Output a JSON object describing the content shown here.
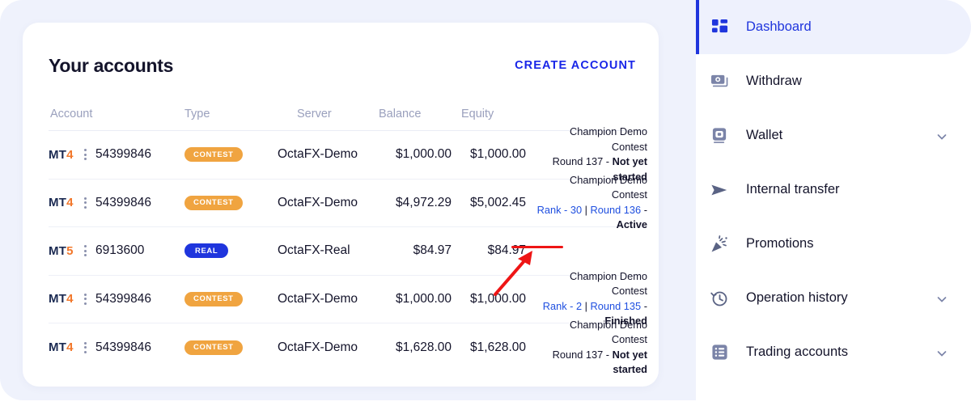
{
  "card": {
    "title": "Your accounts",
    "create_button": "CREATE ACCOUNT"
  },
  "table": {
    "headers": {
      "account": "Account",
      "type": "Type",
      "server": "Server",
      "balance": "Balance",
      "equity": "Equity"
    },
    "rows": [
      {
        "platform_prefix": "MT",
        "platform_version": "4",
        "menu_icon": "kebab-menu-icon",
        "account_number": "54399846",
        "type_badge": "CONTEST",
        "type_badge_kind": "contest",
        "server": "OctaFX-Demo",
        "balance": "$1,000.00",
        "equity": "$1,000.00",
        "status_title": "Champion Demo Contest",
        "rank_label": "",
        "round_label": "Round 137",
        "separator": "",
        "state": "Not yet started",
        "has_rank": false
      },
      {
        "platform_prefix": "MT",
        "platform_version": "4",
        "menu_icon": "kebab-menu-icon",
        "account_number": "54399846",
        "type_badge": "CONTEST",
        "type_badge_kind": "contest",
        "server": "OctaFX-Demo",
        "balance": "$4,972.29",
        "equity": "$5,002.45",
        "status_title": "Champion Demo Contest",
        "rank_label": "Rank - 30",
        "round_label": "Round 136",
        "separator": "|",
        "state": "Active",
        "has_rank": true
      },
      {
        "platform_prefix": "MT",
        "platform_version": "5",
        "menu_icon": "kebab-menu-icon",
        "account_number": "6913600",
        "type_badge": "REAL",
        "type_badge_kind": "real",
        "server": "OctaFX-Real",
        "balance": "$84.97",
        "equity": "$84.97",
        "status_title": "",
        "rank_label": "",
        "round_label": "",
        "separator": "",
        "state": "",
        "has_rank": false
      },
      {
        "platform_prefix": "MT",
        "platform_version": "4",
        "menu_icon": "kebab-menu-icon",
        "account_number": "54399846",
        "type_badge": "CONTEST",
        "type_badge_kind": "contest",
        "server": "OctaFX-Demo",
        "balance": "$1,000.00",
        "equity": "$1,000.00",
        "status_title": "Champion Demo Contest",
        "rank_label": "Rank - 2",
        "round_label": "Round 135",
        "separator": "|",
        "state": "Finished",
        "has_rank": true
      },
      {
        "platform_prefix": "MT",
        "platform_version": "4",
        "menu_icon": "kebab-menu-icon",
        "account_number": "54399846",
        "type_badge": "CONTEST",
        "type_badge_kind": "contest",
        "server": "OctaFX-Demo",
        "balance": "$1,628.00",
        "equity": "$1,628.00",
        "status_title": "Champion Demo Contest",
        "rank_label": "",
        "round_label": "Round 137",
        "separator": "",
        "state": "Not yet started",
        "has_rank": false
      }
    ]
  },
  "sidebar": {
    "items": [
      {
        "label": "Dashboard",
        "icon": "dashboard-grid-icon",
        "active": true,
        "chevron": false
      },
      {
        "label": "Withdraw",
        "icon": "banknotes-icon",
        "active": false,
        "chevron": false
      },
      {
        "label": "Wallet",
        "icon": "wallet-icon",
        "active": false,
        "chevron": true
      },
      {
        "label": "Internal transfer",
        "icon": "send-arrow-icon",
        "active": false,
        "chevron": false
      },
      {
        "label": "Promotions",
        "icon": "party-popper-icon",
        "active": false,
        "chevron": false
      },
      {
        "label": "Operation history",
        "icon": "clock-rewind-icon",
        "active": false,
        "chevron": true
      },
      {
        "label": "Trading accounts",
        "icon": "list-box-icon",
        "active": false,
        "chevron": true
      }
    ]
  },
  "annotations": {
    "arrow": "red-arrow-annotation",
    "underline": "red-underline-annotation"
  },
  "colors": {
    "page_bg": "#eff2fc",
    "accent_blue": "#1f35dd",
    "link_blue": "#1f4fe0",
    "contest_orange": "#f0a440",
    "annotation_red": "#ee1515",
    "text_dark": "#14142b",
    "muted": "#9aa0bd"
  }
}
